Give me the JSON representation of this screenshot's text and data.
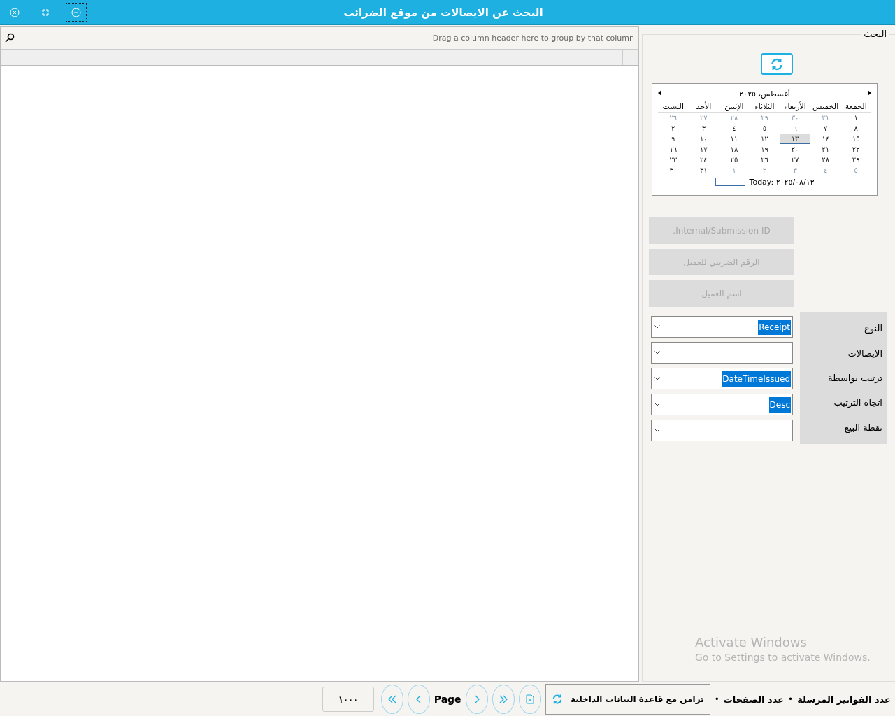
{
  "window": {
    "title": "البحث عن الايصالات من موقع الضرائب"
  },
  "grid": {
    "group_hint": "Drag a column header here to group by that column"
  },
  "search_panel": {
    "legend": "البحث",
    "calendar": {
      "month": "أغسطس، ٢٠٢٥",
      "weekdays": [
        "الجمعة",
        "الخميس",
        "الأربعاء",
        "الثلاثاء",
        "الإثنين",
        "الأحد",
        "السبت"
      ],
      "weeks": [
        [
          {
            "day": "١",
            "other_month": false,
            "selected": false
          },
          {
            "day": "٣١",
            "other_month": true,
            "selected": false
          },
          {
            "day": "٣٠",
            "other_month": true,
            "selected": false
          },
          {
            "day": "٢٩",
            "other_month": true,
            "selected": false
          },
          {
            "day": "٢٨",
            "other_month": true,
            "selected": false
          },
          {
            "day": "٢٧",
            "other_month": true,
            "selected": false
          },
          {
            "day": "٢٦",
            "other_month": true,
            "selected": false
          }
        ],
        [
          {
            "day": "٨",
            "other_month": false,
            "selected": false
          },
          {
            "day": "٧",
            "other_month": false,
            "selected": false
          },
          {
            "day": "٦",
            "other_month": false,
            "selected": false
          },
          {
            "day": "٥",
            "other_month": false,
            "selected": false
          },
          {
            "day": "٤",
            "other_month": false,
            "selected": false
          },
          {
            "day": "٣",
            "other_month": false,
            "selected": false
          },
          {
            "day": "٢",
            "other_month": false,
            "selected": false
          }
        ],
        [
          {
            "day": "١٥",
            "other_month": false,
            "selected": false
          },
          {
            "day": "١٤",
            "other_month": false,
            "selected": false
          },
          {
            "day": "١٣",
            "other_month": false,
            "selected": true
          },
          {
            "day": "١٢",
            "other_month": false,
            "selected": false
          },
          {
            "day": "١١",
            "other_month": false,
            "selected": false
          },
          {
            "day": "١٠",
            "other_month": false,
            "selected": false
          },
          {
            "day": "٩",
            "other_month": false,
            "selected": false
          }
        ],
        [
          {
            "day": "٢٢",
            "other_month": false,
            "selected": false
          },
          {
            "day": "٢١",
            "other_month": false,
            "selected": false
          },
          {
            "day": "٢٠",
            "other_month": false,
            "selected": false
          },
          {
            "day": "١٩",
            "other_month": false,
            "selected": false
          },
          {
            "day": "١٨",
            "other_month": false,
            "selected": false
          },
          {
            "day": "١٧",
            "other_month": false,
            "selected": false
          },
          {
            "day": "١٦",
            "other_month": false,
            "selected": false
          }
        ],
        [
          {
            "day": "٢٩",
            "other_month": false,
            "selected": false
          },
          {
            "day": "٢٨",
            "other_month": false,
            "selected": false
          },
          {
            "day": "٢٧",
            "other_month": false,
            "selected": false
          },
          {
            "day": "٢٦",
            "other_month": false,
            "selected": false
          },
          {
            "day": "٢٥",
            "other_month": false,
            "selected": false
          },
          {
            "day": "٢٤",
            "other_month": false,
            "selected": false
          },
          {
            "day": "٢٣",
            "other_month": false,
            "selected": false
          }
        ],
        [
          {
            "day": "٥",
            "other_month": true,
            "selected": false
          },
          {
            "day": "٤",
            "other_month": true,
            "selected": false
          },
          {
            "day": "٣",
            "other_month": true,
            "selected": false
          },
          {
            "day": "٢",
            "other_month": true,
            "selected": false
          },
          {
            "day": "١",
            "other_month": true,
            "selected": false
          },
          {
            "day": "٣١",
            "other_month": false,
            "selected": false
          },
          {
            "day": "٣٠",
            "other_month": false,
            "selected": false
          }
        ]
      ],
      "today": "Today: ٢٠٢٥/٠٨/١٣"
    },
    "text_fields": [
      {
        "placeholder": ".Internal/Submission ID",
        "disabled": true
      },
      {
        "placeholder": "الرقم الضريبي للعميل",
        "disabled": true
      },
      {
        "placeholder": "اسم العميل",
        "disabled": true
      }
    ],
    "filters": [
      {
        "label": "النوع",
        "value": "Receipt"
      },
      {
        "label": "الايصالات"
      },
      {
        "label": "ترتيب بواسطة",
        "value": "DateTimeIssued"
      },
      {
        "label": "اتجاه الترتيب",
        "value": "Desc"
      },
      {
        "label": "نقطة البيع"
      }
    ]
  },
  "os_notice": {
    "title": "Activate Windows",
    "subtitle": "Go to Settings to activate Windows."
  },
  "status_bar": {
    "items": [
      {
        "kind": "label",
        "text": "عدد الفواتير المرسلة"
      },
      {
        "kind": "bullet",
        "text": "•"
      },
      {
        "kind": "label",
        "text": "عدد الصفحات"
      },
      {
        "kind": "bullet",
        "text": "•"
      }
    ],
    "sync_button": "تزامن مع قاعدة البيانات الداخلية",
    "page_label": "Page",
    "page_size": "١٠٠٠"
  }
}
